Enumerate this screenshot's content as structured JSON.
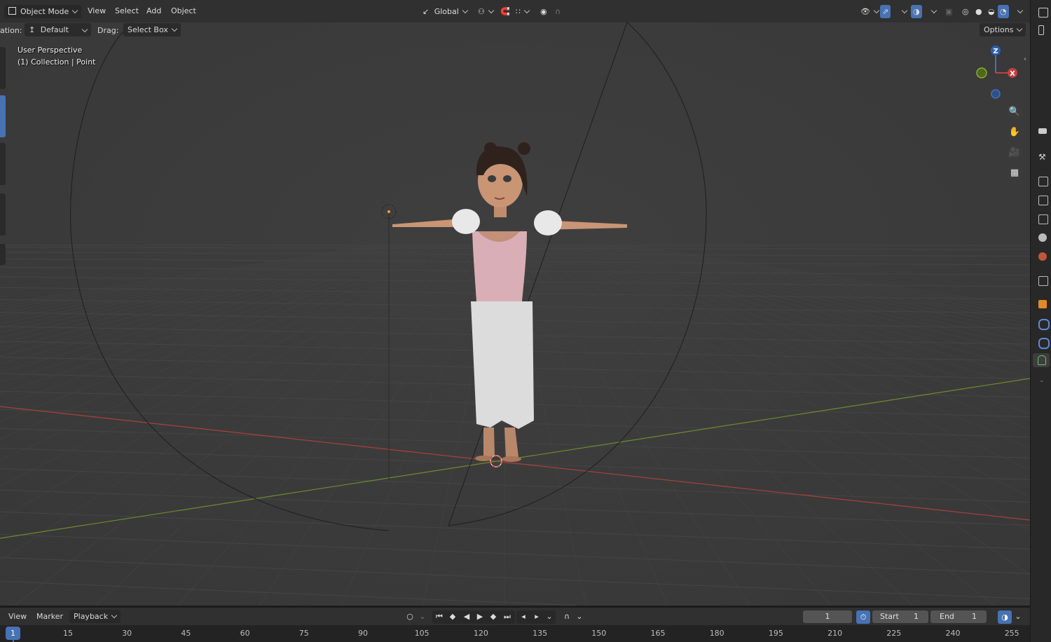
{
  "header": {
    "mode": "Object Mode",
    "menus": [
      "View",
      "Select",
      "Add",
      "Object"
    ],
    "transform_orientation": "Global",
    "options_label": "Options"
  },
  "tool_settings": {
    "orientation_label": "ation:",
    "orientation_value": "Default",
    "drag_label": "Drag:",
    "drag_value": "Select Box"
  },
  "viewport": {
    "view_name": "User Perspective",
    "collection_info": "(1) Collection | Point"
  },
  "gizmo": {
    "z_label": "Z",
    "x_label": "X"
  },
  "timeline": {
    "menus": [
      "View",
      "Marker",
      "Playback"
    ],
    "current_frame": "1",
    "start_label": "Start",
    "start_value": "1",
    "end_label": "End",
    "end_value": "1",
    "ruler_current": "1",
    "ruler_ticks": [
      "15",
      "30",
      "45",
      "60",
      "75",
      "90",
      "105",
      "120",
      "135",
      "150",
      "165",
      "180",
      "195",
      "210",
      "225",
      "240",
      "255"
    ]
  },
  "colors": {
    "x_axis": "#c4403f",
    "y_axis": "#7ea233",
    "accent": "#4772b3"
  }
}
